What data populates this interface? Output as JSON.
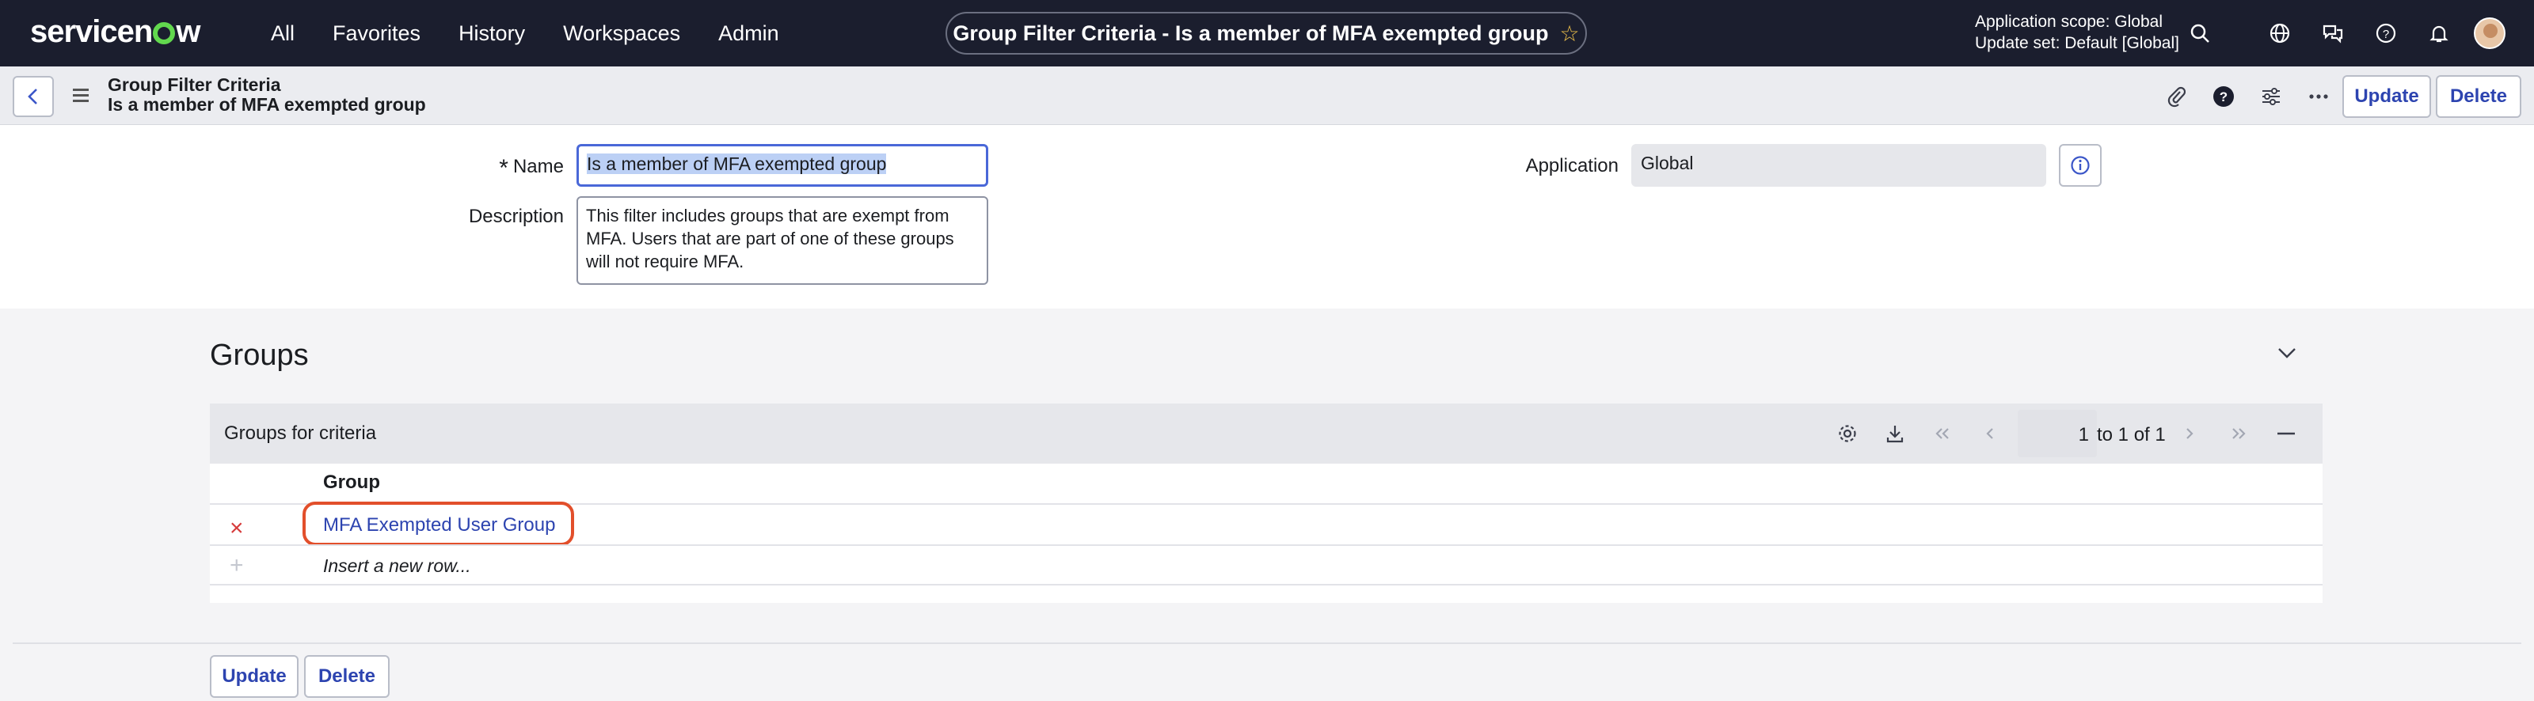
{
  "nav": {
    "logo": "servicenow",
    "links": [
      "All",
      "Favorites",
      "History",
      "Workspaces",
      "Admin"
    ],
    "title": "Group Filter Criteria - Is a member of MFA exempted group",
    "scope_line1": "Application scope: Global",
    "scope_line2": "Update set: Default [Global]"
  },
  "header": {
    "record_type": "Group Filter Criteria",
    "record_name": "Is a member of MFA exempted group",
    "update_label": "Update",
    "delete_label": "Delete"
  },
  "form": {
    "name_label": "Name",
    "name_value": "Is a member of MFA exempted group",
    "description_label": "Description",
    "description_value": "This filter includes groups that are exempt from MFA. Users that are part of one of these groups will not require MFA.",
    "application_label": "Application",
    "application_value": "Global"
  },
  "groups": {
    "section_title": "Groups",
    "list_title": "Groups for criteria",
    "page_current": "1",
    "page_range": "to 1 of 1",
    "column_header": "Group",
    "rows": [
      {
        "group": "MFA Exempted User Group"
      }
    ],
    "insert_label": "Insert a new row..."
  },
  "footer": {
    "update_label": "Update",
    "delete_label": "Delete"
  },
  "colors": {
    "nav_bg": "#1b1e2e",
    "link": "#2d44b0",
    "highlight": "#e24f2b",
    "delete_x": "#d63b3b"
  }
}
